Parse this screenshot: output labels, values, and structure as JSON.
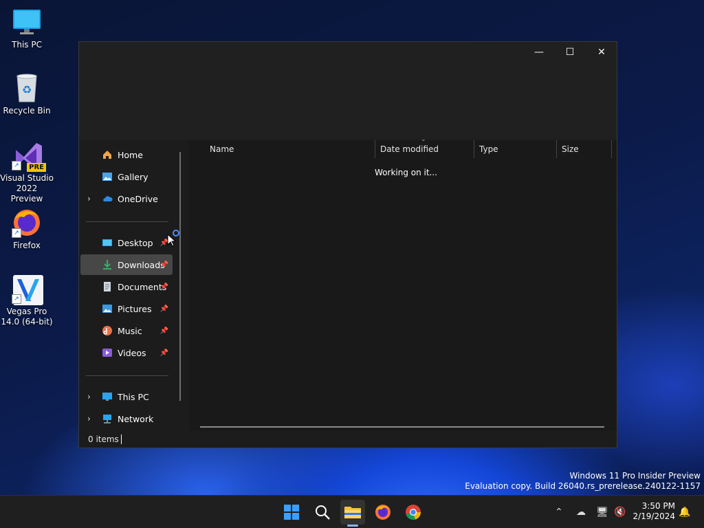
{
  "desktop": {
    "icons": [
      {
        "label": "This PC",
        "icon": "monitor-icon"
      },
      {
        "label": "Recycle Bin",
        "icon": "recycle-bin-icon"
      },
      {
        "label": "Visual Studio 2022 Preview",
        "icon": "visual-studio-icon",
        "badge": "PRE"
      },
      {
        "label": "Firefox",
        "icon": "firefox-icon"
      },
      {
        "label": "Vegas Pro 14.0 (64-bit)",
        "icon": "vegas-pro-icon"
      }
    ]
  },
  "explorer": {
    "window_controls": {
      "minimize": "—",
      "maximize": "☐",
      "close": "✕"
    },
    "nav": {
      "home": "Home",
      "gallery": "Gallery",
      "onedrive": "OneDrive",
      "desktop": "Desktop",
      "downloads": "Downloads",
      "documents": "Documents",
      "pictures": "Pictures",
      "music": "Music",
      "videos": "Videos",
      "this_pc": "This PC",
      "network": "Network"
    },
    "columns": [
      "Name",
      "Date modified",
      "Type",
      "Size"
    ],
    "status_message": "Working on it...",
    "status_bar": "0 items"
  },
  "watermark": {
    "line1": "Windows 11 Pro Insider Preview",
    "line2": "Evaluation copy. Build 26040.rs_prerelease.240122-1157"
  },
  "taskbar": {
    "apps": [
      "start-icon",
      "search-icon",
      "file-explorer-icon",
      "firefox-icon",
      "chrome-icon"
    ],
    "time": "3:50 PM",
    "date": "2/19/2024"
  },
  "colors": {
    "accent": "#0078d4",
    "selection": "#474747",
    "window_bg": "#1c1c1c"
  }
}
